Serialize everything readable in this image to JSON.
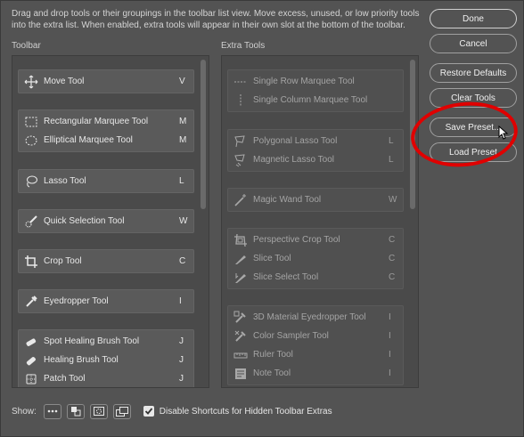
{
  "description": "Drag and drop tools or their groupings in the toolbar list view. Move excess, unused, or low priority tools into the extra list. When enabled, extra tools will appear in their own slot at the bottom of the toolbar.",
  "toolbar": {
    "title": "Toolbar",
    "groups": [
      [
        {
          "label": "Move Tool",
          "key": "V",
          "icon": "move-icon"
        }
      ],
      [
        {
          "label": "Rectangular Marquee Tool",
          "key": "M",
          "icon": "rect-marquee-icon"
        },
        {
          "label": "Elliptical Marquee Tool",
          "key": "M",
          "icon": "ellipse-marquee-icon"
        }
      ],
      [
        {
          "label": "Lasso Tool",
          "key": "L",
          "icon": "lasso-icon"
        }
      ],
      [
        {
          "label": "Quick Selection Tool",
          "key": "W",
          "icon": "quick-selection-icon"
        }
      ],
      [
        {
          "label": "Crop Tool",
          "key": "C",
          "icon": "crop-icon"
        }
      ],
      [
        {
          "label": "Eyedropper Tool",
          "key": "I",
          "icon": "eyedropper-icon"
        }
      ],
      [
        {
          "label": "Spot Healing Brush Tool",
          "key": "J",
          "icon": "spot-healing-icon"
        },
        {
          "label": "Healing Brush Tool",
          "key": "J",
          "icon": "healing-brush-icon"
        },
        {
          "label": "Patch Tool",
          "key": "J",
          "icon": "patch-icon"
        }
      ]
    ]
  },
  "extra": {
    "title": "Extra Tools",
    "groups": [
      [
        {
          "label": "Single Row Marquee Tool",
          "key": "",
          "icon": "single-row-icon"
        },
        {
          "label": "Single Column Marquee Tool",
          "key": "",
          "icon": "single-column-icon"
        }
      ],
      [
        {
          "label": "Polygonal Lasso Tool",
          "key": "L",
          "icon": "polygonal-lasso-icon"
        },
        {
          "label": "Magnetic Lasso Tool",
          "key": "L",
          "icon": "magnetic-lasso-icon"
        }
      ],
      [
        {
          "label": "Magic Wand Tool",
          "key": "W",
          "icon": "magic-wand-icon"
        }
      ],
      [
        {
          "label": "Perspective Crop Tool",
          "key": "C",
          "icon": "perspective-crop-icon"
        },
        {
          "label": "Slice Tool",
          "key": "C",
          "icon": "slice-icon"
        },
        {
          "label": "Slice Select Tool",
          "key": "C",
          "icon": "slice-select-icon"
        }
      ],
      [
        {
          "label": "3D Material Eyedropper Tool",
          "key": "I",
          "icon": "3d-eyedropper-icon"
        },
        {
          "label": "Color Sampler Tool",
          "key": "I",
          "icon": "color-sampler-icon"
        },
        {
          "label": "Ruler Tool",
          "key": "I",
          "icon": "ruler-icon"
        },
        {
          "label": "Note Tool",
          "key": "I",
          "icon": "note-icon"
        }
      ]
    ]
  },
  "buttons": {
    "done": "Done",
    "cancel": "Cancel",
    "restore": "Restore Defaults",
    "clear": "Clear Tools",
    "save": "Save Preset...",
    "load": "Load Preset"
  },
  "bottom": {
    "show_label": "Show:",
    "checkbox_label": "Disable Shortcuts for Hidden Toolbar Extras",
    "checkbox_checked": true
  },
  "annotation_color": "#e00000"
}
